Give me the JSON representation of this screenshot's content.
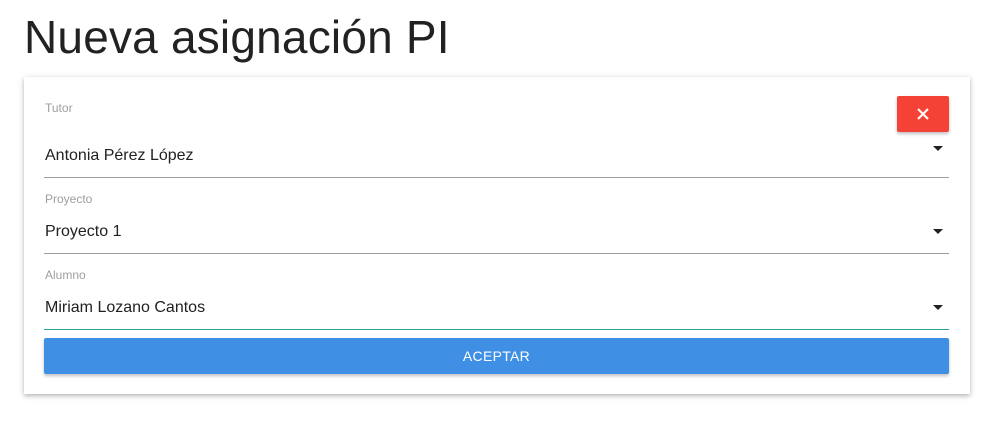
{
  "page": {
    "title": "Nueva asignación PI"
  },
  "form": {
    "close_icon": "close-icon",
    "fields": [
      {
        "label": "Tutor",
        "value": "Antonia Pérez López"
      },
      {
        "label": "Proyecto",
        "value": "Proyecto 1"
      },
      {
        "label": "Alumno",
        "value": "Miriam Lozano Cantos"
      }
    ],
    "submit_label": "ACEPTAR"
  },
  "colors": {
    "close_button": "#f44336",
    "accept_button": "#3f8fe5",
    "active_underline": "#26a69a"
  }
}
